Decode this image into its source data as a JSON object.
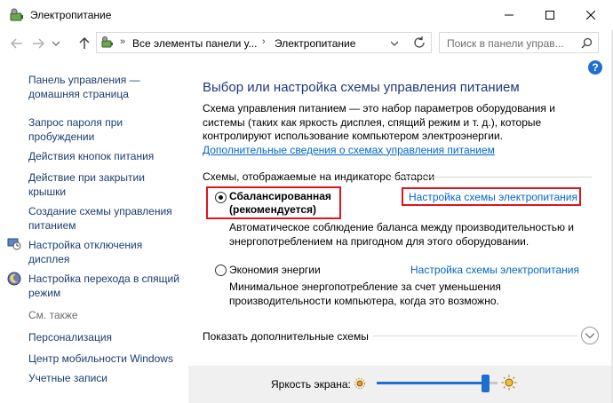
{
  "window": {
    "title": "Электропитание"
  },
  "address_bar": {
    "crumbs": [
      "Все элементы панели у...",
      "Электропитание"
    ],
    "search_placeholder": "Поиск в панели управ..."
  },
  "sidebar": {
    "items": [
      {
        "label": "Панель управления — домашняя страница"
      },
      {
        "label": "Запрос пароля при пробуждении"
      },
      {
        "label": "Действия кнопок питания"
      },
      {
        "label": "Действие при закрытии крышки"
      },
      {
        "label": "Создание схемы управления питанием"
      },
      {
        "label": "Настройка отключения дисплея"
      },
      {
        "label": "Настройка перехода в спящий режим"
      }
    ],
    "see_also_heading": "См. также",
    "see_also": [
      {
        "label": "Персонализация"
      },
      {
        "label": "Центр мобильности Windows"
      },
      {
        "label": "Учетные записи"
      }
    ]
  },
  "main": {
    "title": "Выбор или настройка схемы управления питанием",
    "intro_text": "Схема управления питанием — это набор параметров оборудования и системы (таких как яркость дисплея, спящий режим и т. д.), которые контролируют использование компьютером электроэнергии.",
    "intro_link": "Дополнительные сведения о схемах управления питанием",
    "section_label": "Схемы, отображаемые на индикаторе батареи",
    "plans": [
      {
        "name": "Сбалансированная (рекомендуется)",
        "selected": true,
        "link": "Настройка схемы электропитания",
        "description": "Автоматическое соблюдение баланса между производительностью и энергопотреблением на пригодном для этого оборудовании."
      },
      {
        "name": "Экономия энергии",
        "selected": false,
        "link": "Настройка схемы электропитания",
        "description": "Минимальное энергопотребление за счет уменьшения производительности компьютера, когда это возможно."
      }
    ],
    "more_plans": "Показать дополнительные схемы"
  },
  "brightness": {
    "label": "Яркость экрана:",
    "level_fraction": 0.9
  },
  "colors": {
    "link": "#0066cc",
    "title": "#1e3a78",
    "highlight": "#e0141e",
    "accent": "#1e6fd0"
  },
  "icons": [
    "battery-control-panel-icon",
    "back-arrow-icon",
    "forward-arrow-icon",
    "up-arrow-icon",
    "refresh-icon",
    "search-icon",
    "help-icon",
    "clock-monitor-icon",
    "moon-sleep-icon",
    "chevron-down-icon",
    "sun-dim-icon",
    "sun-bright-icon"
  ]
}
